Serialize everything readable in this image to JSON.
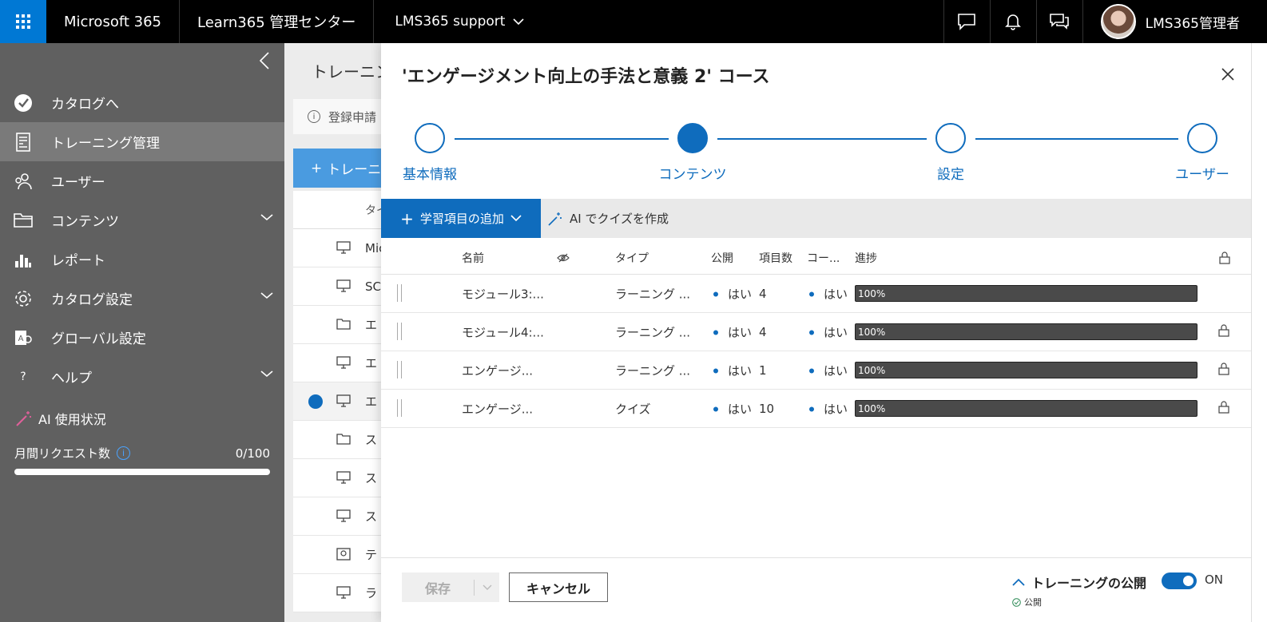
{
  "header": {
    "brand": "Microsoft 365",
    "admin_center": "Learn365 管理センター",
    "tenant": "LMS365 support",
    "user_name": "LMS365管理者"
  },
  "sidebar": {
    "items": [
      {
        "label": "カタログへ",
        "icon": "catalog-check-icon"
      },
      {
        "label": "トレーニング管理",
        "icon": "training-doc-icon",
        "active": true
      },
      {
        "label": "ユーザー",
        "icon": "users-icon"
      },
      {
        "label": "コンテンツ",
        "icon": "folder-icon",
        "expandable": true
      },
      {
        "label": "レポート",
        "icon": "bar-chart-icon"
      },
      {
        "label": "カタログ設定",
        "icon": "gear-icon",
        "expandable": true
      },
      {
        "label": "グローバル設定",
        "icon": "global-settings-icon"
      },
      {
        "label": "ヘルプ",
        "icon": "help-icon",
        "expandable": true
      }
    ],
    "ai_usage_label": "AI 使用状況",
    "monthly_requests_label": "月間リクエスト数",
    "monthly_requests_count": "0/100",
    "monthly_requests_used_fraction": 0
  },
  "background_page": {
    "title": "トレーニング",
    "info_text": "登録申請",
    "add_button": "トレーニ",
    "column_header": "タイ",
    "rows": [
      "Mic",
      "SC",
      "エ",
      "エ",
      "エ",
      "ス",
      "ス",
      "ス",
      "テ",
      "ラ"
    ]
  },
  "panel": {
    "title": "'エンゲージメント向上の手法と意義 2' コース",
    "steps": [
      {
        "label": "基本情報",
        "state": "done"
      },
      {
        "label": "コンテンツ",
        "state": "current"
      },
      {
        "label": "設定",
        "state": "todo"
      },
      {
        "label": "ユーザー",
        "state": "todo"
      }
    ],
    "toolbar": {
      "add_label": "学習項目の追加",
      "ai_quiz_label": "AI でクイズを作成"
    },
    "table": {
      "headers": {
        "name": "名前",
        "type": "タイプ",
        "published": "公開",
        "item_count": "項目数",
        "course": "コー...",
        "progress": "進捗"
      },
      "rows": [
        {
          "name": "モジュール3:...",
          "type": "ラーニング ...",
          "published": "はい",
          "count": "4",
          "course": "はい",
          "progress_label": "100%",
          "progress": 1.0,
          "locked": false
        },
        {
          "name": "モジュール4:...",
          "type": "ラーニング ...",
          "published": "はい",
          "count": "4",
          "course": "はい",
          "progress_label": "100%",
          "progress": 1.0,
          "locked": true
        },
        {
          "name": "エンゲージ...",
          "type": "ラーニング ...",
          "published": "はい",
          "count": "1",
          "course": "はい",
          "progress_label": "100%",
          "progress": 1.0,
          "locked": true
        },
        {
          "name": "エンゲージ...",
          "type": "クイズ",
          "published": "はい",
          "count": "10",
          "course": "はい",
          "progress_label": "100%",
          "progress": 1.0,
          "locked": true
        }
      ]
    },
    "footer": {
      "save_label": "保存",
      "cancel_label": "キャンセル",
      "publish_label": "トレーニングの公開",
      "publish_status": "公開",
      "toggle_label": "ON",
      "toggle_on": true
    }
  },
  "colors": {
    "accent": "#0f6cbd",
    "topbar": "#000000",
    "sidebar": "#606060"
  }
}
